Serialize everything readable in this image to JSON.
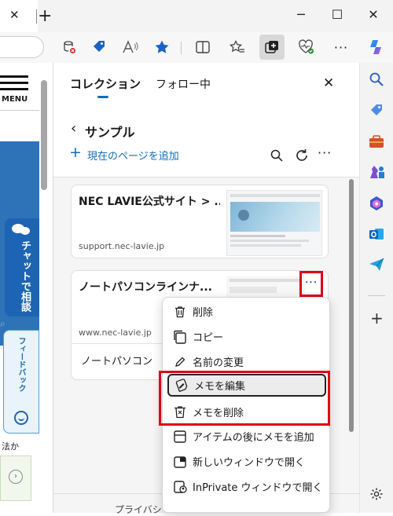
{
  "titlebar": {
    "close_tab": "✕",
    "new_tab": "+"
  },
  "window_controls": {
    "minimize": "─",
    "maximize": "☐",
    "close": "✕"
  },
  "left_page": {
    "menu_label": "MENU",
    "chat_label": "チャットで相談",
    "feedback_label": "フィードバック",
    "bottom_text": "法か"
  },
  "collections": {
    "tab_collections": "コレクション",
    "tab_following": "フォロー中",
    "collection_name": "サンプル",
    "add_page": "現在のページを追加",
    "items": [
      {
        "title": "NEC LAVIE公式サイト > ...",
        "url": "support.nec-lavie.jp"
      },
      {
        "title": "ノートパソコンラインナ...",
        "url": "www.nec-lavie.jp",
        "note": "ノートパソコン"
      }
    ],
    "footer": "プライバシー"
  },
  "context_menu": {
    "items": [
      {
        "label": "削除",
        "icon": "trash-icon"
      },
      {
        "label": "コピー",
        "icon": "copy-icon"
      },
      {
        "label": "名前の変更",
        "icon": "rename-icon"
      },
      {
        "label": "メモを編集",
        "icon": "edit-note-icon"
      },
      {
        "label": "メモを削除",
        "icon": "delete-note-icon"
      },
      {
        "label": "アイテムの後にメモを追加",
        "icon": "add-note-icon"
      },
      {
        "label": "新しいウィンドウで開く",
        "icon": "new-window-icon"
      },
      {
        "label": "InPrivate ウィンドウで開く",
        "icon": "inprivate-icon"
      }
    ]
  },
  "colors": {
    "accent": "#0f6cbd",
    "highlight_red": "#e0001a",
    "page_blue": "#2e73b8"
  }
}
